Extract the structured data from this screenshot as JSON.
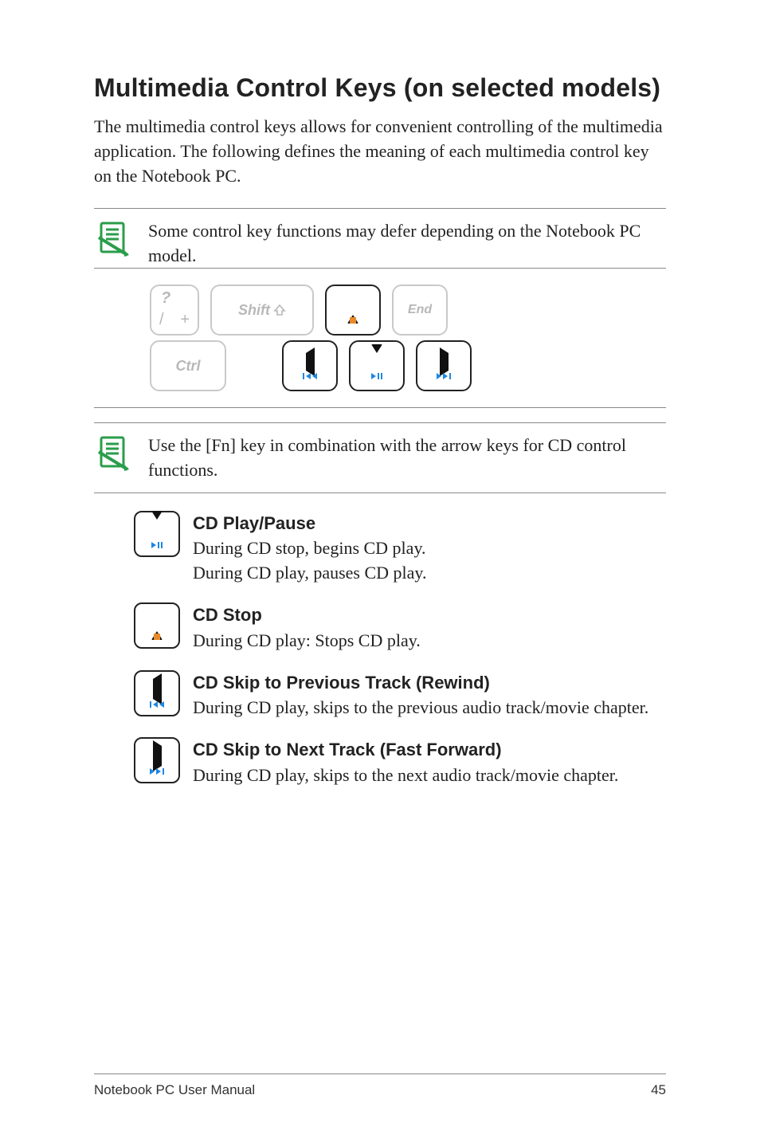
{
  "title": "Multimedia Control Keys (on selected models)",
  "intro": "The multimedia control keys allows for convenient controlling of the multimedia application. The following defines the meaning of each multimedia control key on the Notebook PC.",
  "notes": {
    "top": "Some control key functions may defer depending on the Notebook PC model.",
    "mid": "Use the [Fn] key in combination with the arrow keys for CD control functions."
  },
  "keyboard": {
    "row1": {
      "slashplus": {
        "top": "?",
        "left": "/",
        "right": "+"
      },
      "shift": "Shift",
      "end": "End"
    },
    "row2": {
      "ctrl": "Ctrl"
    }
  },
  "functions": {
    "playpause": {
      "title": "CD Play/Pause",
      "line1": "During CD stop, begins CD play.",
      "line2": "During CD play, pauses CD play."
    },
    "stop": {
      "title": "CD Stop",
      "line1": "During CD play: Stops CD play."
    },
    "prev": {
      "title": "CD Skip to Previous Track (Rewind)",
      "line1": "During CD play, skips to the previous audio track/movie chapter."
    },
    "next": {
      "title": "CD Skip to Next Track (Fast Forward)",
      "line1": "During CD play, skips to the next audio track/movie chapter."
    }
  },
  "footer": {
    "left": "Notebook PC User Manual",
    "right": "45"
  }
}
